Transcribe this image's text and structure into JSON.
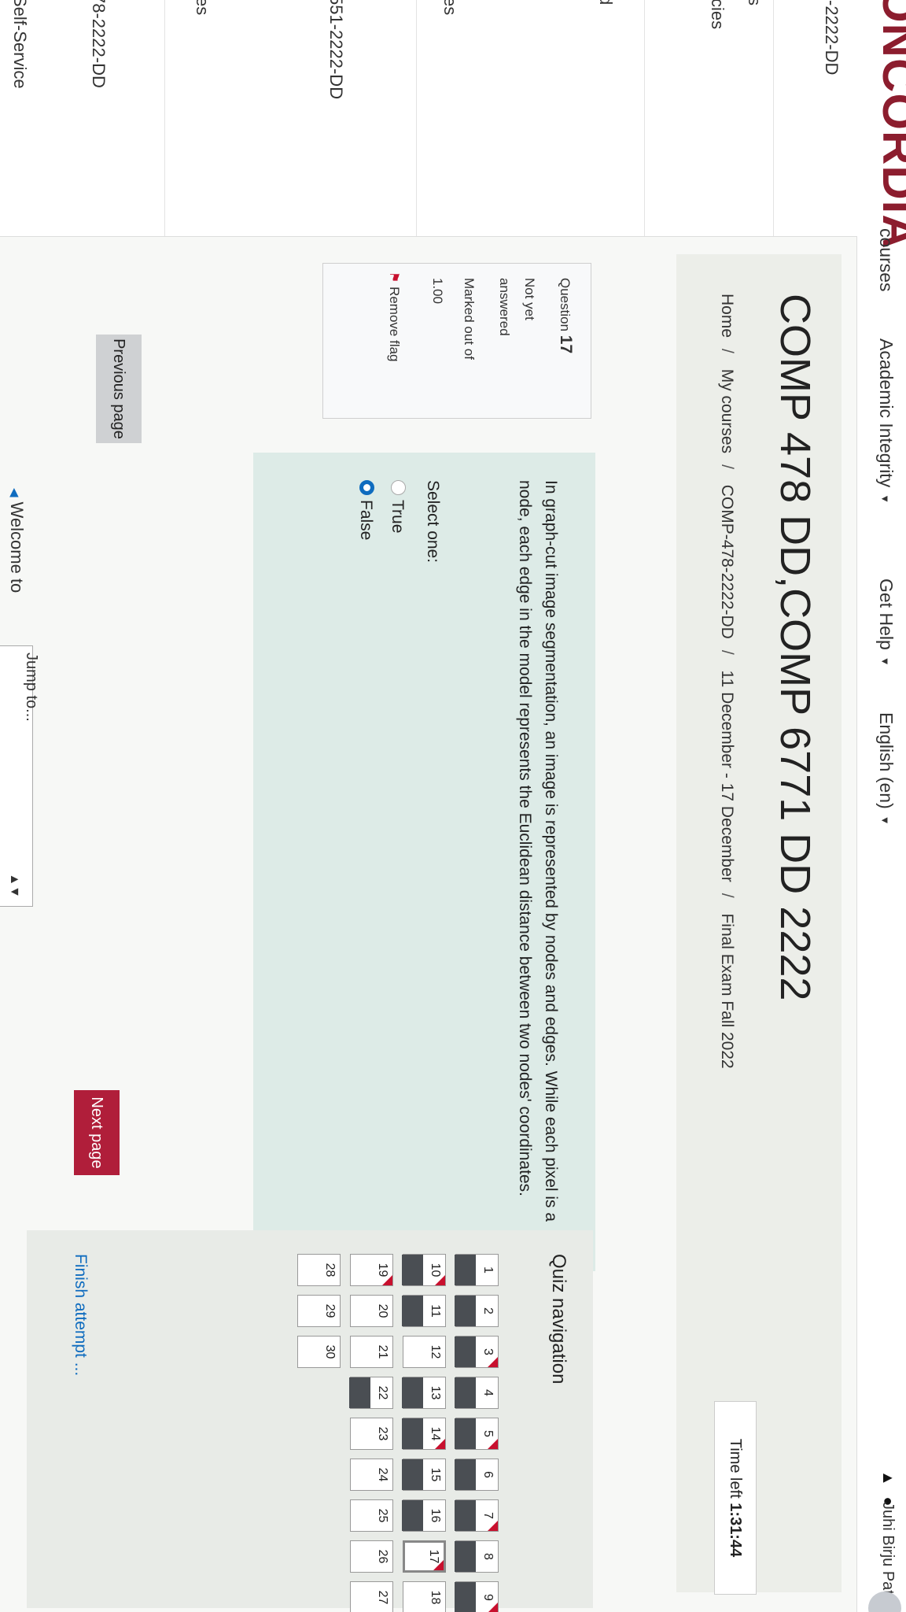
{
  "topbar": {
    "logo": "ONCORDIA",
    "nav_courses": "courses",
    "nav_integrity": "Academic Integrity",
    "nav_help": "Get Help",
    "nav_language": "English (en)",
    "user_name": "Juhi Birju Patel"
  },
  "left_panel": {
    "items": [
      "-2222-DD",
      "s",
      "cies",
      "d",
      "es",
      "551-2222-DD",
      "es",
      "78-2222-DD",
      "Self-Service"
    ]
  },
  "header": {
    "title": "COMP 478 DD,COMP 6771 DD 2222",
    "breadcrumb": [
      "Home",
      "My courses",
      "COMP-478-2222-DD",
      "11 December - 17 December",
      "Final Exam Fall 2022"
    ]
  },
  "timer": {
    "label": "Time left",
    "value": "1:31:44"
  },
  "question": {
    "label": "Question",
    "number": "17",
    "status_line1": "Not yet",
    "status_line2": "answered",
    "mark_line1": "Marked out of",
    "mark_line2": "1.00",
    "flag_label": "Remove flag",
    "text": "In graph-cut image segmentation, an image is represented by nodes and edges. While each pixel is a node, each edge in the model represents the Euclidean distance between two nodes' coordinates.",
    "select_one": "Select one:",
    "options": [
      "True",
      "False"
    ],
    "selected": "False"
  },
  "buttons": {
    "previous": "Previous page",
    "next": "Next page"
  },
  "footer": {
    "welcome": "Welcome to",
    "jump_to": "Jump to..."
  },
  "quiz_nav": {
    "title": "Quiz navigation",
    "finish": "Finish attempt ...",
    "items": [
      {
        "n": "1",
        "answered": true,
        "flagged": false
      },
      {
        "n": "2",
        "answered": true,
        "flagged": false
      },
      {
        "n": "3",
        "answered": true,
        "flagged": true
      },
      {
        "n": "4",
        "answered": true,
        "flagged": false
      },
      {
        "n": "5",
        "answered": true,
        "flagged": true
      },
      {
        "n": "6",
        "answered": true,
        "flagged": false
      },
      {
        "n": "7",
        "answered": true,
        "flagged": true
      },
      {
        "n": "8",
        "answered": true,
        "flagged": false
      },
      {
        "n": "9",
        "answered": true,
        "flagged": true
      },
      {
        "n": "10",
        "answered": true,
        "flagged": true
      },
      {
        "n": "11",
        "answered": true,
        "flagged": false
      },
      {
        "n": "12",
        "answered": false,
        "flagged": false
      },
      {
        "n": "13",
        "answered": true,
        "flagged": false
      },
      {
        "n": "14",
        "answered": true,
        "flagged": true
      },
      {
        "n": "15",
        "answered": true,
        "flagged": false
      },
      {
        "n": "16",
        "answered": true,
        "flagged": false
      },
      {
        "n": "17",
        "answered": false,
        "flagged": true,
        "current": true
      },
      {
        "n": "18",
        "answered": false,
        "flagged": false
      },
      {
        "n": "19",
        "answered": false,
        "flagged": true
      },
      {
        "n": "20",
        "answered": false,
        "flagged": false
      },
      {
        "n": "21",
        "answered": false,
        "flagged": false
      },
      {
        "n": "22",
        "answered": true,
        "flagged": false
      },
      {
        "n": "23",
        "answered": false,
        "flagged": false
      },
      {
        "n": "24",
        "answered": false,
        "flagged": false
      },
      {
        "n": "25",
        "answered": false,
        "flagged": false
      },
      {
        "n": "26",
        "answered": false,
        "flagged": false
      },
      {
        "n": "27",
        "answered": false,
        "flagged": false
      },
      {
        "n": "28",
        "answered": false,
        "flagged": false
      },
      {
        "n": "29",
        "answered": false,
        "flagged": false
      },
      {
        "n": "30",
        "answered": false,
        "flagged": false
      }
    ]
  }
}
